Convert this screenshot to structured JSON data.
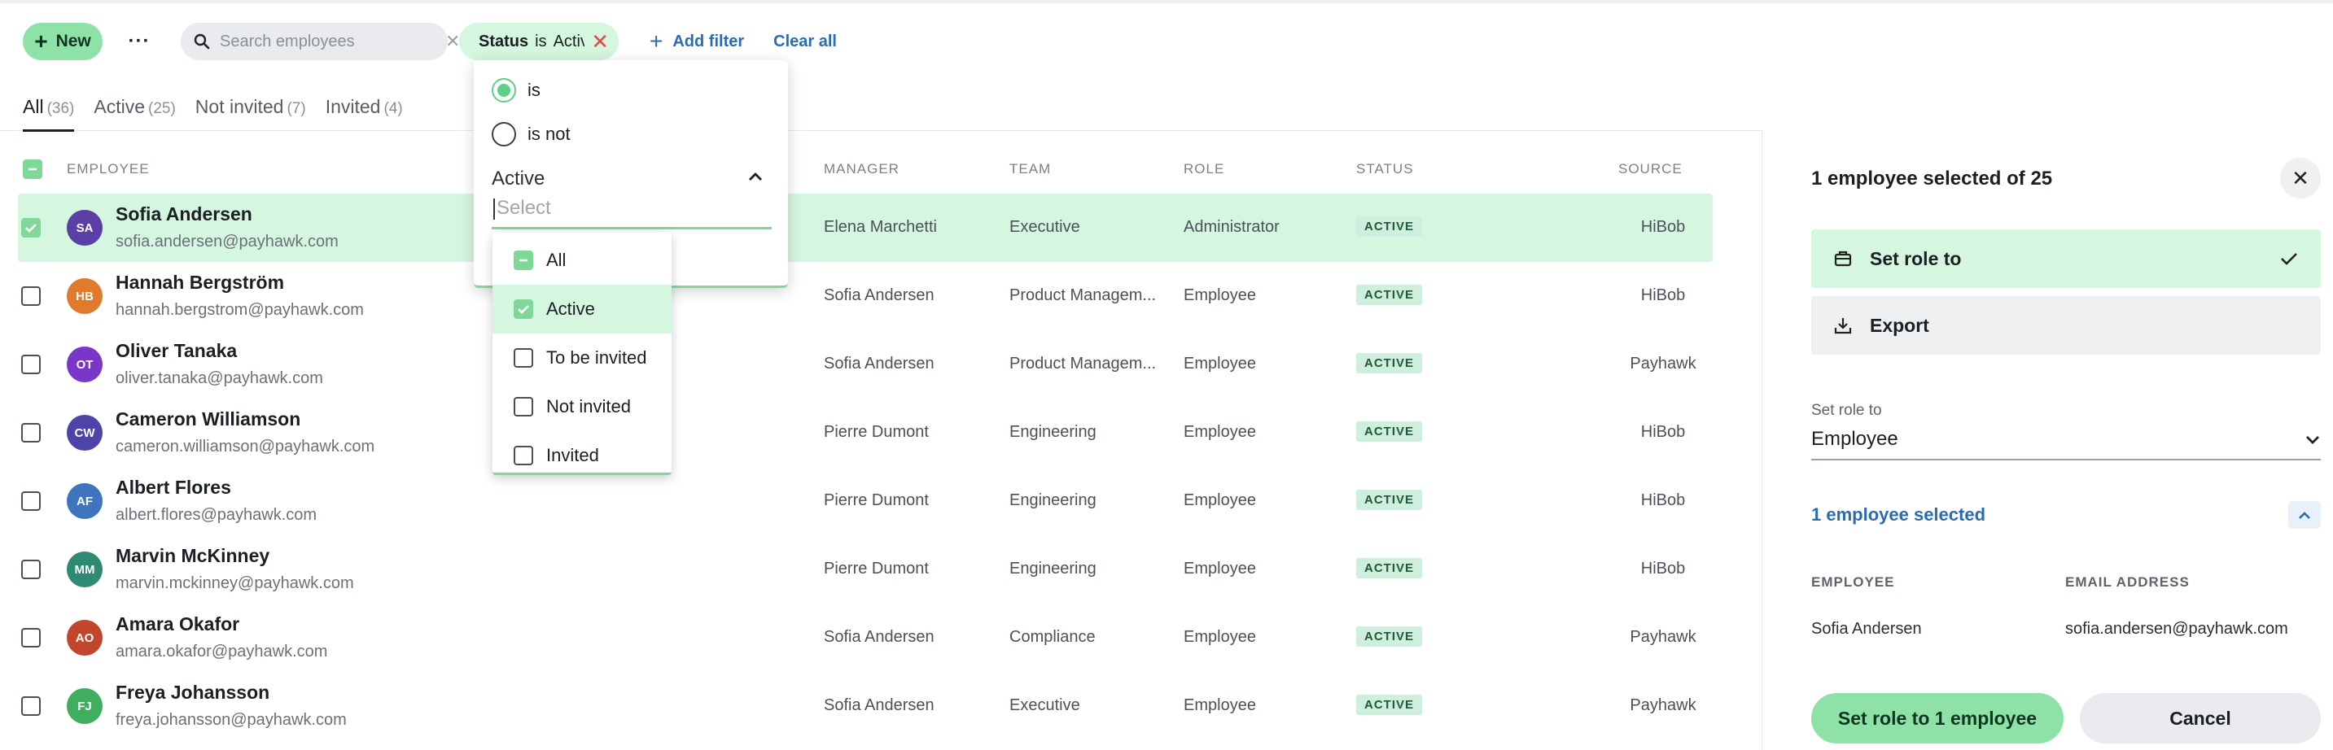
{
  "toolbar": {
    "new_label": "New",
    "more_label": "···",
    "search_placeholder": "Search employees",
    "filter_chip": {
      "field": "Status",
      "op": "is",
      "value": "Active"
    },
    "add_filter_label": "Add filter",
    "clear_all_label": "Clear all"
  },
  "tabs": [
    {
      "label": "All",
      "count": "(36)"
    },
    {
      "label": "Active",
      "count": "(25)"
    },
    {
      "label": "Not invited",
      "count": "(7)"
    },
    {
      "label": "Invited",
      "count": "(4)"
    }
  ],
  "table": {
    "headers": {
      "employee": "EMPLOYEE",
      "manager": "MANAGER",
      "team": "TEAM",
      "role": "ROLE",
      "status": "STATUS",
      "source": "SOURCE"
    },
    "rows": [
      {
        "initials": "SA",
        "color": "#5b3fa6",
        "name": "Sofia Andersen",
        "email": "sofia.andersen@payhawk.com",
        "manager": "Elena Marchetti",
        "team": "Executive",
        "role": "Administrator",
        "status": "ACTIVE",
        "source": "HiBob",
        "selected": true
      },
      {
        "initials": "HB",
        "color": "#e07b2e",
        "name": "Hannah Bergström",
        "email": "hannah.bergstrom@payhawk.com",
        "manager": "Sofia Andersen",
        "team": "Product Managem...",
        "role": "Employee",
        "status": "ACTIVE",
        "source": "HiBob",
        "selected": false
      },
      {
        "initials": "OT",
        "color": "#7a35c9",
        "name": "Oliver Tanaka",
        "email": "oliver.tanaka@payhawk.com",
        "manager": "Sofia Andersen",
        "team": "Product Managem...",
        "role": "Employee",
        "status": "ACTIVE",
        "source": "Payhawk",
        "selected": false
      },
      {
        "initials": "CW",
        "color": "#4e44a8",
        "name": "Cameron Williamson",
        "email": "cameron.williamson@payhawk.com",
        "manager": "Pierre Dumont",
        "team": "Engineering",
        "role": "Employee",
        "status": "ACTIVE",
        "source": "HiBob",
        "selected": false
      },
      {
        "initials": "AF",
        "color": "#3f74bf",
        "name": "Albert Flores",
        "email": "albert.flores@payhawk.com",
        "manager": "Pierre Dumont",
        "team": "Engineering",
        "role": "Employee",
        "status": "ACTIVE",
        "source": "HiBob",
        "selected": false
      },
      {
        "initials": "MM",
        "color": "#2e8a72",
        "name": "Marvin McKinney",
        "email": "marvin.mckinney@payhawk.com",
        "manager": "Pierre Dumont",
        "team": "Engineering",
        "role": "Employee",
        "status": "ACTIVE",
        "source": "HiBob",
        "selected": false
      },
      {
        "initials": "AO",
        "color": "#c2452d",
        "name": "Amara Okafor",
        "email": "amara.okafor@payhawk.com",
        "manager": "Sofia Andersen",
        "team": "Compliance",
        "role": "Employee",
        "status": "ACTIVE",
        "source": "Payhawk",
        "selected": false
      },
      {
        "initials": "FJ",
        "color": "#3fae5f",
        "name": "Freya Johansson",
        "email": "freya.johansson@payhawk.com",
        "manager": "Sofia Andersen",
        "team": "Executive",
        "role": "Employee",
        "status": "ACTIVE",
        "source": "Payhawk",
        "selected": false
      }
    ]
  },
  "filter_dropdown": {
    "radio_is": "is",
    "radio_is_not": "is not",
    "selected_label": "Active",
    "select_placeholder": "Select",
    "options": [
      {
        "label": "All",
        "state": "partial"
      },
      {
        "label": "Active",
        "state": "checked"
      },
      {
        "label": "To be invited",
        "state": "unchecked"
      },
      {
        "label": "Not invited",
        "state": "unchecked"
      },
      {
        "label": "Invited",
        "state": "unchecked"
      }
    ]
  },
  "side_panel": {
    "title": "1 employee selected of 25",
    "action_set_role": "Set role to",
    "action_export": "Export",
    "field_label": "Set role to",
    "field_value": "Employee",
    "selected_count": "1 employee selected",
    "col_employee": "EMPLOYEE",
    "col_email": "EMAIL ADDRESS",
    "sel_employee": "Sofia Andersen",
    "sel_email": "sofia.andersen@payhawk.com",
    "primary_button": "Set role to 1 employee",
    "cancel_button": "Cancel"
  }
}
